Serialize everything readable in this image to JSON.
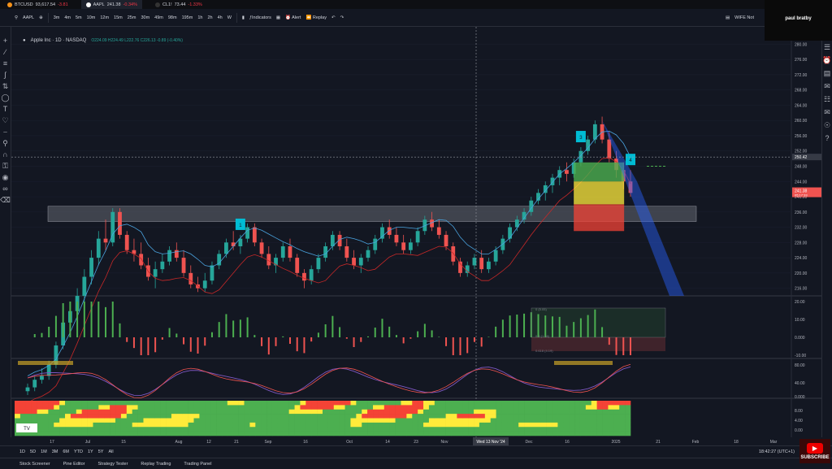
{
  "tabs": [
    {
      "symbol": "BTCUSD",
      "price": "93,617.54",
      "change": "-3.81",
      "dot": "#f7931a",
      "active": false
    },
    {
      "symbol": "AAPL",
      "price": "241.38",
      "change": "-0.34%",
      "dot": "#ffffff",
      "active": true
    },
    {
      "symbol": "CL1!",
      "price": "73.44",
      "change": "-1.33%",
      "dot": "#333333",
      "active": false
    }
  ],
  "toolbar": {
    "symbol": "AAPL",
    "intervals": [
      "3m",
      "4m",
      "5m",
      "10m",
      "12m",
      "15m",
      "25m",
      "30m",
      "49m",
      "98m",
      "195m",
      "1h",
      "2h",
      "4h",
      "W"
    ],
    "indicators_label": "Indicators",
    "alert_label": "Alert",
    "replay_label": "Replay",
    "layout_name": "WIFE Not"
  },
  "webcam": {
    "name": "paul bratby"
  },
  "legend": {
    "title": "Apple Inc · 1D · NASDAQ",
    "ohlc": "O224.09 H224.49 L222.76 C226.13 -0.89 (-0.40%)"
  },
  "chart_data": {
    "type": "candlestick",
    "price_axis": [
      "280.00",
      "276.00",
      "272.00",
      "268.00",
      "264.00",
      "260.00",
      "256.00",
      "252.00",
      "248.00",
      "244.00",
      "240.00",
      "236.00",
      "232.00",
      "228.00",
      "224.00",
      "220.00",
      "216.00"
    ],
    "price_labels": {
      "cursor": "250.42",
      "last": "241.38",
      "last_sub": "05:17:33"
    },
    "price_range": [
      214,
      282
    ],
    "resistance_zone": [
      233.5,
      237.5
    ],
    "candles": [
      [
        189,
        191,
        188,
        190
      ],
      [
        190,
        193,
        189,
        192
      ],
      [
        192,
        195,
        191,
        193
      ],
      [
        193,
        197,
        192,
        196
      ],
      [
        196,
        202,
        195,
        201
      ],
      [
        201,
        208,
        200,
        207
      ],
      [
        207,
        212,
        205,
        210
      ],
      [
        210,
        216,
        208,
        214
      ],
      [
        214,
        221,
        212,
        219
      ],
      [
        219,
        226,
        217,
        224
      ],
      [
        224,
        231,
        222,
        229
      ],
      [
        229,
        234,
        226,
        228
      ],
      [
        228,
        237,
        227,
        236
      ],
      [
        236,
        237,
        229,
        230
      ],
      [
        230,
        231,
        225,
        226
      ],
      [
        226,
        229,
        223,
        225
      ],
      [
        225,
        228,
        221,
        222
      ],
      [
        222,
        224,
        218,
        219
      ],
      [
        219,
        223,
        216,
        221
      ],
      [
        221,
        225,
        220,
        223
      ],
      [
        223,
        227,
        222,
        226
      ],
      [
        226,
        228,
        223,
        224
      ],
      [
        224,
        226,
        219,
        220
      ],
      [
        220,
        222,
        216,
        217
      ],
      [
        217,
        219,
        215,
        216
      ],
      [
        216,
        220,
        215,
        218
      ],
      [
        218,
        223,
        217,
        222
      ],
      [
        222,
        226,
        221,
        225
      ],
      [
        225,
        229,
        224,
        228
      ],
      [
        228,
        231,
        226,
        227
      ],
      [
        227,
        230,
        225,
        229
      ],
      [
        229,
        233,
        228,
        232
      ],
      [
        232,
        233,
        227,
        228
      ],
      [
        228,
        229,
        224,
        225
      ],
      [
        225,
        227,
        221,
        222
      ],
      [
        222,
        225,
        220,
        224
      ],
      [
        224,
        228,
        223,
        227
      ],
      [
        227,
        229,
        223,
        224
      ],
      [
        224,
        225,
        219,
        220
      ],
      [
        220,
        221,
        216,
        218
      ],
      [
        218,
        222,
        217,
        221
      ],
      [
        221,
        225,
        220,
        224
      ],
      [
        224,
        228,
        223,
        227
      ],
      [
        227,
        231,
        226,
        230
      ],
      [
        230,
        231,
        226,
        227
      ],
      [
        227,
        229,
        223,
        224
      ],
      [
        224,
        226,
        221,
        222
      ],
      [
        222,
        225,
        220,
        224
      ],
      [
        224,
        227,
        223,
        226
      ],
      [
        226,
        230,
        225,
        229
      ],
      [
        229,
        233,
        228,
        232
      ],
      [
        232,
        234,
        229,
        230
      ],
      [
        230,
        232,
        227,
        228
      ],
      [
        228,
        230,
        225,
        226
      ],
      [
        226,
        229,
        225,
        228
      ],
      [
        228,
        232,
        227,
        231
      ],
      [
        231,
        235,
        230,
        234
      ],
      [
        234,
        236,
        231,
        232
      ],
      [
        232,
        234,
        229,
        230
      ],
      [
        230,
        231,
        226,
        227
      ],
      [
        227,
        228,
        222,
        223
      ],
      [
        223,
        224,
        219,
        220
      ],
      [
        220,
        223,
        219,
        222
      ],
      [
        222,
        225,
        221,
        224
      ],
      [
        224,
        226,
        220,
        221
      ],
      [
        221,
        224,
        220,
        223
      ],
      [
        223,
        227,
        222,
        226
      ],
      [
        226,
        230,
        225,
        229
      ],
      [
        229,
        233,
        228,
        232
      ],
      [
        232,
        235,
        231,
        234
      ],
      [
        234,
        237,
        233,
        236
      ],
      [
        236,
        240,
        235,
        239
      ],
      [
        239,
        242,
        238,
        241
      ],
      [
        241,
        244,
        239,
        243
      ],
      [
        243,
        246,
        241,
        245
      ],
      [
        245,
        248,
        243,
        247
      ],
      [
        247,
        249,
        244,
        246
      ],
      [
        246,
        250,
        245,
        249
      ],
      [
        249,
        253,
        248,
        252
      ],
      [
        252,
        256,
        251,
        255
      ],
      [
        255,
        260,
        254,
        259
      ],
      [
        259,
        261,
        254,
        255
      ],
      [
        255,
        257,
        249,
        250
      ],
      [
        250,
        252,
        245,
        247
      ],
      [
        247,
        249,
        242,
        244
      ],
      [
        244,
        247,
        240,
        241
      ]
    ],
    "markers": [
      {
        "label": "1",
        "candle": 30
      },
      {
        "label": "3",
        "candle": 78
      },
      {
        "label": "4",
        "candle": 85
      }
    ],
    "macd_axis": [
      "20.00",
      "10.00",
      "0.000",
      "-10.00"
    ],
    "macd_levels": [
      "0 (5.05)",
      "0.5 (1.36)",
      "0.618 (4.19)"
    ],
    "stoch_axis": [
      "80.00",
      "40.00",
      "0.000"
    ],
    "bottom_axis": [
      "8.00",
      "4.00",
      "0.00"
    ],
    "time_axis": [
      "17",
      "Jul",
      "15",
      "Aug",
      "12",
      "21",
      "Sep",
      "16",
      "Oct",
      "14",
      "23",
      "Nov",
      "Wed 13 Nov '24",
      "Dec",
      "16",
      "2025",
      "21",
      "Feb",
      "18",
      "Mar"
    ],
    "colors": {
      "up": "#26a69a",
      "down": "#ef5350",
      "green": "#4caf50",
      "red": "#f44336",
      "yellow": "#ffeb3b",
      "blue": "#2962ff"
    }
  },
  "ranges": [
    "1D",
    "5D",
    "1M",
    "3M",
    "6M",
    "YTD",
    "1Y",
    "5Y",
    "All"
  ],
  "clock": "18:42:27 (UTC+1)",
  "bottombar": [
    "Stock Screener",
    "Pine Editor",
    "Strategy Tester",
    "Replay Trading",
    "Trading Panel"
  ],
  "subscribe_label": "SUBSCRIBE"
}
